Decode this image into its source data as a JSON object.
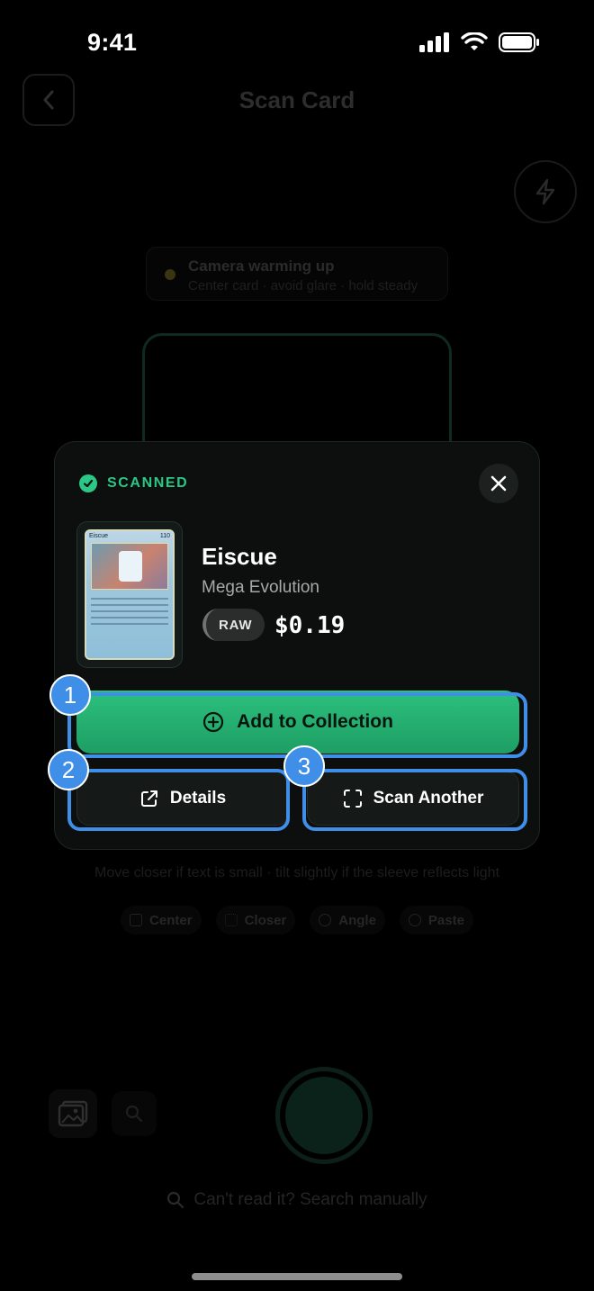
{
  "status_bar": {
    "time": "9:41"
  },
  "header": {
    "title": "Scan Card"
  },
  "camera_status": {
    "title": "Camera warming up",
    "subtitle": "Center card · avoid glare · hold steady"
  },
  "hint": "Move closer if text is small · tilt slightly if the sleeve reflects light",
  "chips": [
    {
      "label": "Center",
      "icon": "frame-icon"
    },
    {
      "label": "Closer",
      "icon": "dots-icon"
    },
    {
      "label": "Angle",
      "icon": "sun-icon"
    },
    {
      "label": "Paste",
      "icon": "search-icon"
    }
  ],
  "manual_search": "Can't read it? Search manually",
  "result": {
    "badge": "SCANNED",
    "card": {
      "name": "Eiscue",
      "set": "Mega Evolution",
      "condition": "RAW",
      "price": "$0.19",
      "thumb_name": "Eiscue",
      "thumb_hp": "110"
    },
    "add_label": "Add to Collection",
    "details_label": "Details",
    "scan_another_label": "Scan Another"
  },
  "annotations": [
    "1",
    "2",
    "3"
  ],
  "colors": {
    "accent_green": "#2bc786",
    "annotation_blue": "#3f8ee8"
  }
}
